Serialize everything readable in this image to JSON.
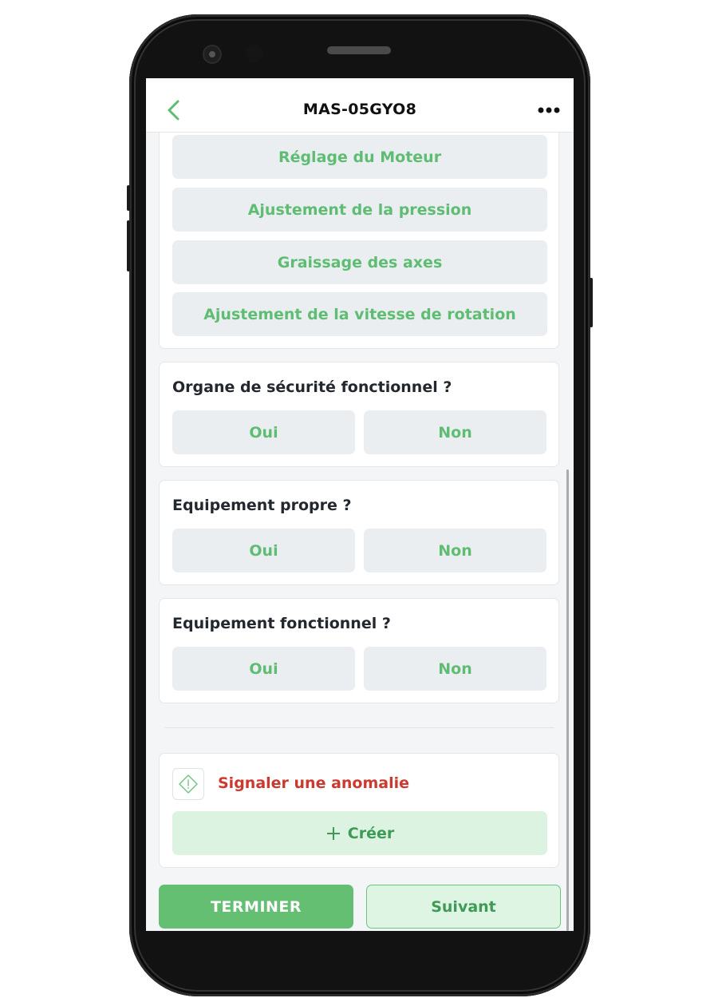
{
  "header": {
    "title": "MAS-05GYO8",
    "back_icon": "chevron-left-icon",
    "menu_icon": "more-horizontal-icon"
  },
  "adjustments": {
    "options": [
      {
        "label": "Réglage du Moteur"
      },
      {
        "label": "Ajustement de la pression"
      },
      {
        "label": "Graissage des axes"
      },
      {
        "label": "Ajustement de la vitesse de rotation"
      }
    ]
  },
  "questions": [
    {
      "label": "Organe de sécurité fonctionnel ?",
      "yes": "Oui",
      "no": "Non"
    },
    {
      "label": "Equipement propre ?",
      "yes": "Oui",
      "no": "Non"
    },
    {
      "label": "Equipement fonctionnel ?",
      "yes": "Oui",
      "no": "Non"
    }
  ],
  "anomaly": {
    "icon": "warning-diamond-icon",
    "label": "Signaler une anomalie",
    "create_label": "Créer",
    "create_icon": "plus-icon"
  },
  "footer": {
    "finish_label": "TERMINER",
    "next_label": "Suivant"
  },
  "colors": {
    "accent_green": "#5ebd72",
    "primary_button": "#64bf73",
    "danger_red": "#cc3a2f",
    "option_bg": "#ebeef1"
  }
}
